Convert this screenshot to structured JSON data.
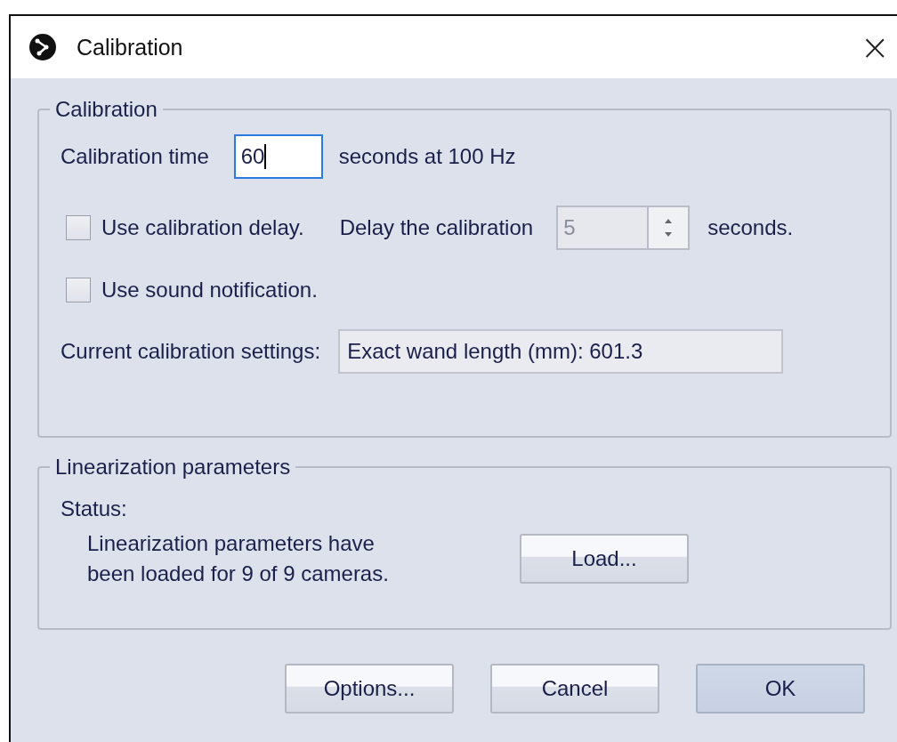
{
  "window": {
    "title": "Calibration",
    "close": "×"
  },
  "calibration_group": {
    "title": "Calibration",
    "time_label": "Calibration time",
    "time_field": {
      "value": "60",
      "focused": true
    },
    "time_unit": "seconds at  100 Hz",
    "options": [
      {
        "label": "Use calibration delay.",
        "checked": false
      },
      {
        "label": "Use sound notification.",
        "checked": false
      }
    ],
    "delay_label": "Delay the calibration",
    "delay_field": {
      "value": "5",
      "disabled": true
    },
    "delay_unit": "seconds.",
    "settings_label": "Current calibration settings:",
    "settings_value": "Exact wand length (mm): 601.3"
  },
  "linearization_group": {
    "title": "Linearization parameters",
    "status_label": "Status:",
    "status_text": "Linearization parameters have\nbeen loaded for 9 of 9 cameras.",
    "load_button": "Load..."
  },
  "buttons": [
    {
      "label": "Options...",
      "default": false
    },
    {
      "label": "Cancel",
      "default": false
    },
    {
      "label": "OK",
      "default": true
    }
  ]
}
